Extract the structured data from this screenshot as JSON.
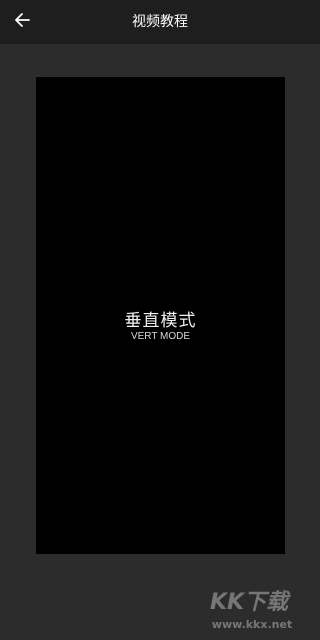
{
  "header": {
    "back_icon": "arrow-left-icon",
    "title": "视频教程"
  },
  "video": {
    "mode_title": "垂直模式",
    "mode_subtitle": "VERT MODE"
  },
  "watermark": {
    "logo": "KK下载",
    "url": "www.kkx.net"
  },
  "colors": {
    "header_bg": "#1e1e1e",
    "page_bg": "#2c2c2c",
    "video_bg": "#000000",
    "text": "#ffffff"
  }
}
